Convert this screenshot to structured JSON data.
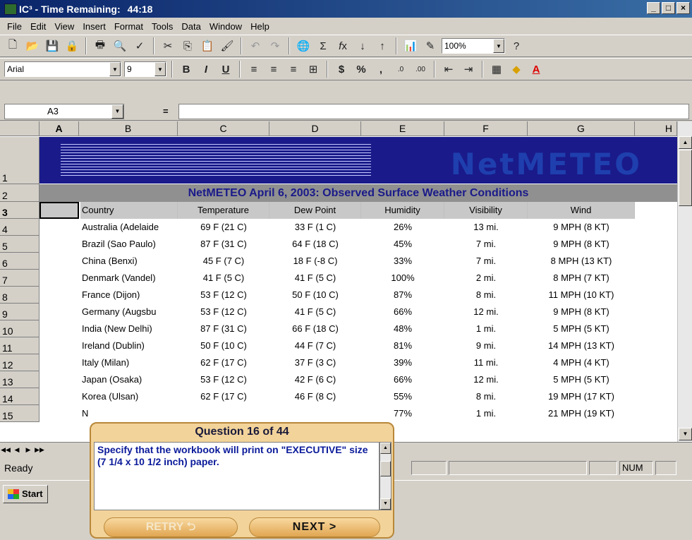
{
  "window": {
    "title": "IC³ - Time Remaining:",
    "timer": "44:18",
    "minimize": "_",
    "maximize": "□",
    "close": "×"
  },
  "menu": [
    "File",
    "Edit",
    "View",
    "Insert",
    "Format",
    "Tools",
    "Data",
    "Window",
    "Help"
  ],
  "toolbar": {
    "zoom": "100%",
    "font": "Arial",
    "font_size": "9",
    "bold": "B",
    "italic": "I",
    "underline": "U",
    "currency": "$",
    "percent": "%",
    "comma": ","
  },
  "formula_bar": {
    "name_box": "A3",
    "equals": "="
  },
  "columns": [
    "A",
    "B",
    "C",
    "D",
    "E",
    "F",
    "G",
    "H"
  ],
  "rows": [
    "1",
    "2",
    "3",
    "4",
    "5",
    "6",
    "7",
    "8",
    "9",
    "10",
    "11",
    "12",
    "13",
    "14",
    "15"
  ],
  "sheet": {
    "brand": "NetMETEO",
    "subtitle": "NetMETEO April 6, 2003: Observed Surface Weather Conditions",
    "headers": [
      "Country",
      "Temperature",
      "Dew Point",
      "Humidity",
      "Visibility",
      "Wind"
    ],
    "data": [
      [
        "Australia (Adelaide",
        "69 F (21 C)",
        "33 F (1 C)",
        "26%",
        "13 mi.",
        "9 MPH  (8 KT)"
      ],
      [
        "Brazil (Sao Paulo)",
        "87 F (31 C)",
        "64 F (18 C)",
        "45%",
        "7 mi.",
        "9 MPH (8 KT)"
      ],
      [
        "China (Benxi)",
        "45 F (7 C)",
        "18 F (-8 C)",
        "33%",
        "7 mi.",
        "8 MPH (13 KT)"
      ],
      [
        "Denmark (Vandel)",
        "41 F (5 C)",
        "41 F (5 C)",
        "100%",
        "2 mi.",
        "8 MPH (7 KT)"
      ],
      [
        "France (Dijon)",
        "53 F (12 C)",
        "50 F (10 C)",
        "87%",
        "8 mi.",
        "11 MPH (10 KT)"
      ],
      [
        "Germany (Augsbu",
        "53 F (12 C)",
        "41 F (5 C)",
        "66%",
        "12 mi.",
        "9 MPH (8 KT)"
      ],
      [
        "India (New Delhi)",
        "87 F (31 C)",
        "66 F (18 C)",
        "48%",
        "1 mi.",
        "5 MPH (5 KT)"
      ],
      [
        "Ireland (Dublin)",
        "50 F (10 C)",
        "44 F (7 C)",
        "81%",
        "9 mi.",
        "14 MPH (13 KT)"
      ],
      [
        "Italy (Milan)",
        "62 F (17 C)",
        "37 F (3 C)",
        "39%",
        "11 mi.",
        "4 MPH (4 KT)"
      ],
      [
        "Japan (Osaka)",
        "53 F (12 C)",
        "42 F (6 C)",
        "66%",
        "12 mi.",
        "5 MPH (5 KT)"
      ],
      [
        "Korea (Ulsan)",
        "62 F (17 C)",
        "46 F (8 C)",
        "55%",
        "8 mi.",
        "19 MPH (17 KT)"
      ],
      [
        "N",
        "",
        "",
        "77%",
        "1 mi.",
        "21 MPH (19 KT)"
      ]
    ]
  },
  "status": {
    "ready": "Ready",
    "num": "NUM"
  },
  "taskbar": {
    "start": "Start"
  },
  "question": {
    "header": "Question 16 of 44",
    "text": "Specify that the workbook will print on \"EXECUTIVE\" size (7 1/4 x 10 1/2 inch) paper.",
    "retry": "RETRY ⮌",
    "next": "NEXT >"
  },
  "icons": [
    "new-icon",
    "open-icon",
    "save-icon",
    "permission-icon",
    "print-icon",
    "print-preview-icon",
    "spelling-icon",
    "cut-icon",
    "copy-icon",
    "paste-icon",
    "format-painter-icon",
    "undo-icon",
    "redo-icon",
    "hyperlink-icon",
    "autosum-icon",
    "function-icon",
    "sort-ascending-icon",
    "sort-descending-icon",
    "chart-wizard-icon",
    "drawing-icon",
    "help-icon"
  ]
}
